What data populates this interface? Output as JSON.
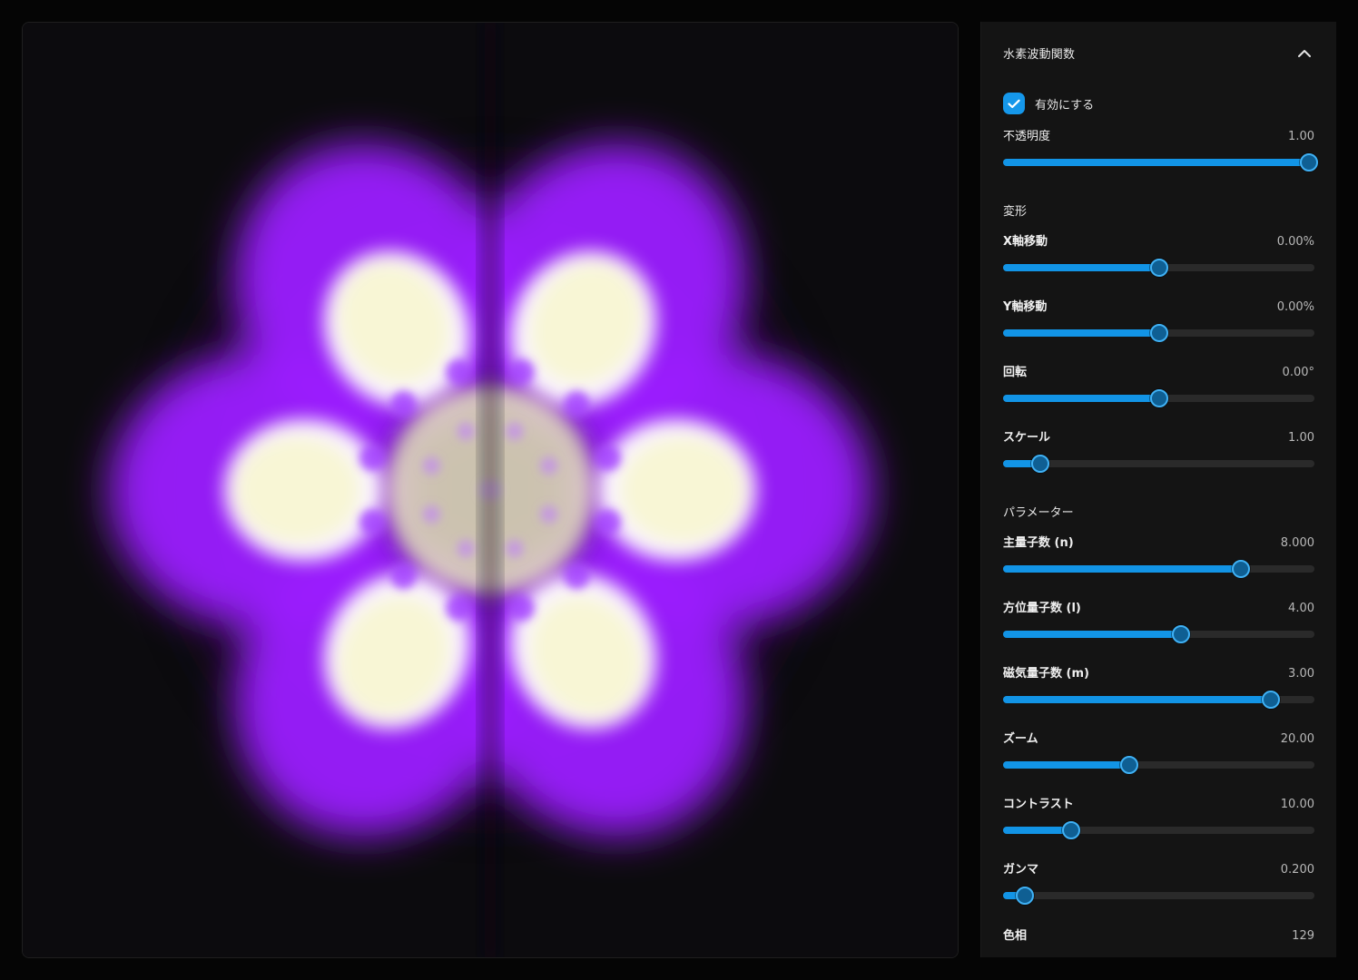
{
  "panel": {
    "title": "水素波動関数",
    "enable_label": "有効にする",
    "enabled": true
  },
  "opacity": {
    "label": "不透明度",
    "value": "1.00",
    "fraction": 1.0
  },
  "sections": {
    "transform": "変形",
    "parameters": "パラメーター"
  },
  "transform": [
    {
      "id": "x-offset",
      "label": "X軸移動",
      "value": "0.00%",
      "fraction": 0.5
    },
    {
      "id": "y-offset",
      "label": "Y軸移動",
      "value": "0.00%",
      "fraction": 0.5
    },
    {
      "id": "rotation",
      "label": "回転",
      "value": "0.00°",
      "fraction": 0.5
    },
    {
      "id": "scale",
      "label": "スケール",
      "value": "1.00",
      "fraction": 0.12
    }
  ],
  "parameters": [
    {
      "id": "n",
      "label": "主量子数 (n)",
      "value": "8.000",
      "fraction": 0.765
    },
    {
      "id": "l",
      "label": "方位量子数 (l)",
      "value": "4.00",
      "fraction": 0.57
    },
    {
      "id": "m",
      "label": "磁気量子数 (m)",
      "value": "3.00",
      "fraction": 0.86
    },
    {
      "id": "zoom",
      "label": "ズーム",
      "value": "20.00",
      "fraction": 0.405
    },
    {
      "id": "contrast",
      "label": "コントラスト",
      "value": "10.00",
      "fraction": 0.218
    },
    {
      "id": "gamma",
      "label": "ガンマ",
      "value": "0.200",
      "fraction": 0.07
    }
  ],
  "hue": {
    "label": "色相",
    "value": "129"
  },
  "colors": {
    "accent": "#1294e6",
    "orbital_glow": "#9b1cff",
    "orbital_core": "#f7f6d0",
    "background": "#050505"
  }
}
